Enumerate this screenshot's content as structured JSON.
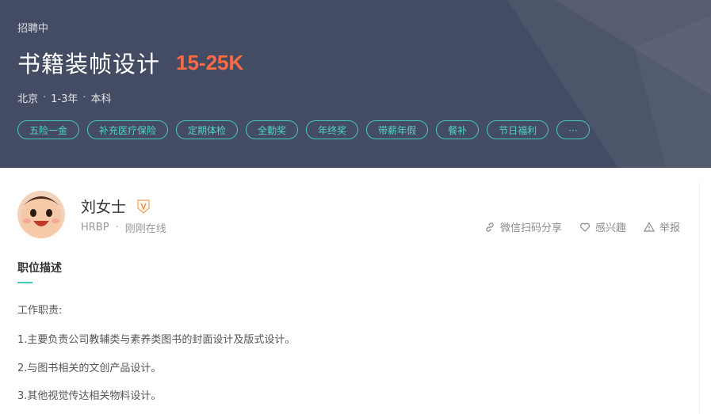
{
  "job": {
    "status": "招聘中",
    "title": "书籍装帧设计",
    "salary": "15-25K",
    "city": "北京",
    "experience": "1-3年",
    "education": "本科",
    "separator": "·",
    "tags": [
      "五险一金",
      "补充医疗保险",
      "定期体检",
      "全勤奖",
      "年终奖",
      "带薪年假",
      "餐补",
      "节日福利",
      "···"
    ]
  },
  "recruiter": {
    "name": "刘女士",
    "role": "HRBP",
    "online": "刚刚在线",
    "badge_icon": "verified-v-icon"
  },
  "actions": {
    "share": "微信扫码分享",
    "interest": "感兴趣",
    "report": "举报"
  },
  "description": {
    "heading": "职位描述",
    "lines": [
      "工作职责:",
      "1.主要负责公司教辅类与素养类图书的封面设计及版式设计。",
      "2.与图书相关的文创产品设计。",
      "3.其他视觉传达相关物料设计。"
    ]
  },
  "colors": {
    "header_bg": "#444c63",
    "salary": "#fe6b45",
    "accent": "#45c8b7"
  }
}
